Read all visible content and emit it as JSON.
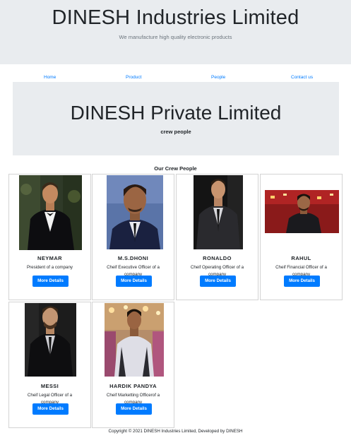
{
  "header": {
    "title": "DINESH Industries Limited",
    "tagline": "We manufacture high quality electronic products"
  },
  "nav": {
    "items": [
      {
        "label": "Home"
      },
      {
        "label": "Product"
      },
      {
        "label": "People"
      },
      {
        "label": "Contact us"
      }
    ]
  },
  "banner": {
    "title": "DINESH Private Limited",
    "subtitle": "crew people"
  },
  "section": {
    "title": "Our Crew People"
  },
  "people": [
    {
      "name": "NEYMAR",
      "role": "President of a company",
      "button": "More Details"
    },
    {
      "name": "M.S.DHONI",
      "role": "Cheif Executive Officer of a company",
      "button": "More Details"
    },
    {
      "name": "RONALDO",
      "role": "Cheif Operating Officer of a company",
      "button": "More Details"
    },
    {
      "name": "RAHUL",
      "role": "Cheif Financial Officer of a company",
      "button": "More Details"
    },
    {
      "name": "MESSI",
      "role": "Cheif Legal Officer of a company",
      "button": "More Details"
    },
    {
      "name": "HARDIK PANDYA",
      "role": "Cheif Marketting Officerof a company",
      "button": "More Details"
    }
  ],
  "footer": {
    "text": "Copyright © 2021 DINESH Industries Limited, Developed by DINESH"
  },
  "colors": {
    "jumbotron_bg": "#e9ecef",
    "link": "#007bff",
    "button": "#007bff",
    "card_border": "#d3d3d3"
  }
}
